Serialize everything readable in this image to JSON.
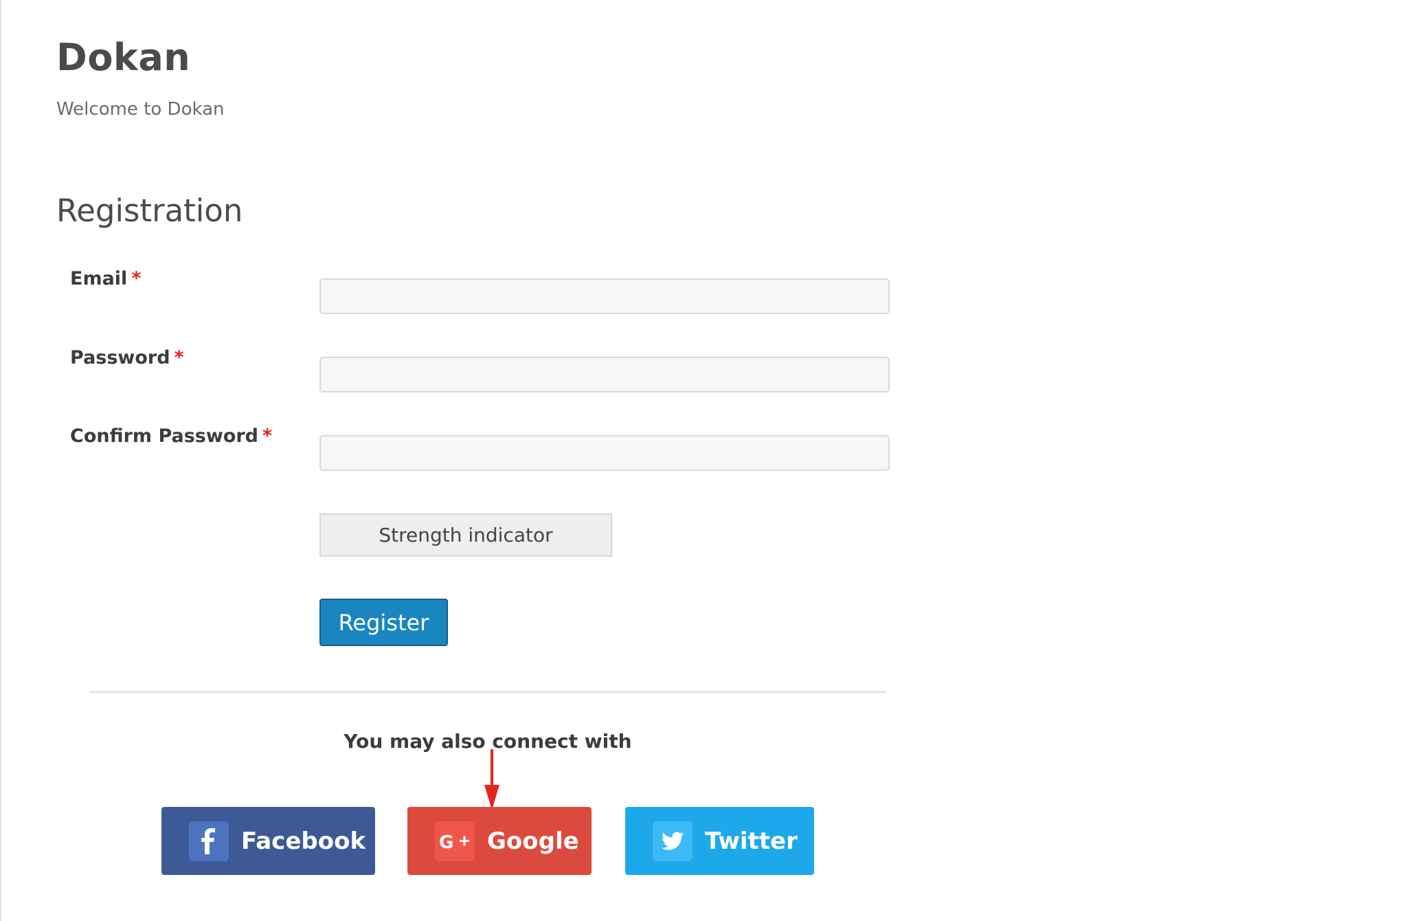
{
  "site": {
    "title": "Dokan",
    "tagline": "Welcome to Dokan"
  },
  "registration": {
    "heading": "Registration",
    "fields": [
      {
        "label": "Email",
        "required_mark": "*",
        "value": "",
        "placeholder": ""
      },
      {
        "label": "Password",
        "required_mark": "*",
        "value": "",
        "placeholder": ""
      },
      {
        "label": "Confirm Password",
        "required_mark": "*",
        "value": "",
        "placeholder": ""
      }
    ],
    "strength_indicator": "Strength indicator",
    "register_label": "Register"
  },
  "social": {
    "connect_text": "You may also connect with",
    "buttons": [
      {
        "label": "Facebook",
        "icon": "facebook-icon",
        "color": "#3d5a96"
      },
      {
        "label": "Google",
        "icon": "google-plus-icon",
        "color": "#dc4a3d"
      },
      {
        "label": "Twitter",
        "icon": "twitter-icon",
        "color": "#1da8ec"
      }
    ]
  },
  "colors": {
    "required": "#e2231a",
    "register_button": "#1a86c0",
    "annotation_arrow": "#e8231a"
  }
}
